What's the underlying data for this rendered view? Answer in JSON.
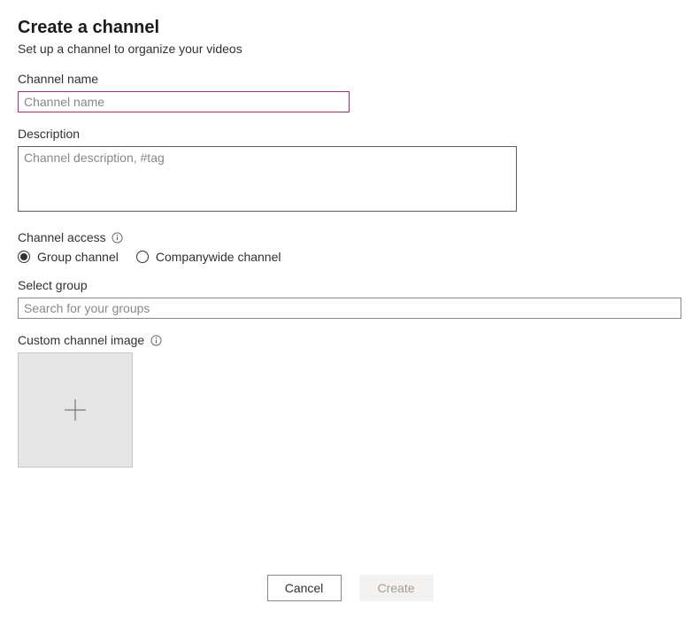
{
  "page": {
    "title": "Create a channel",
    "subtitle": "Set up a channel to organize your videos"
  },
  "channelName": {
    "label": "Channel name",
    "placeholder": "Channel name",
    "value": ""
  },
  "description": {
    "label": "Description",
    "placeholder": "Channel description, #tag",
    "value": ""
  },
  "channelAccess": {
    "label": "Channel access",
    "options": [
      {
        "label": "Group channel",
        "selected": true
      },
      {
        "label": "Companywide channel",
        "selected": false
      }
    ]
  },
  "selectGroup": {
    "label": "Select group",
    "placeholder": "Search for your groups",
    "value": ""
  },
  "customImage": {
    "label": "Custom channel image"
  },
  "buttons": {
    "cancel": "Cancel",
    "create": "Create"
  }
}
